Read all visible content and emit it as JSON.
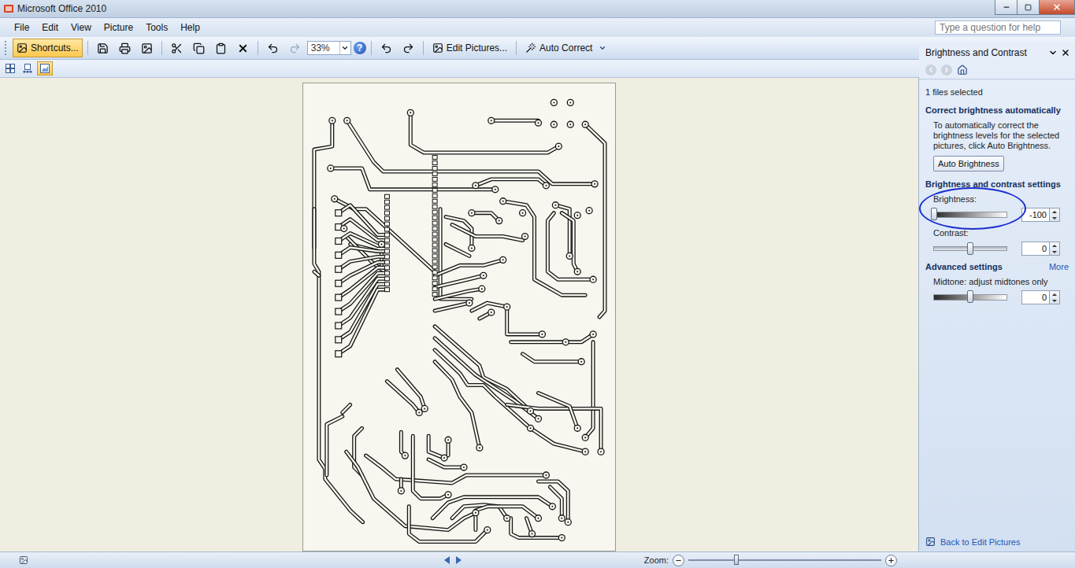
{
  "window": {
    "title": "Microsoft Office 2010"
  },
  "menu": [
    "File",
    "Edit",
    "View",
    "Picture",
    "Tools",
    "Help"
  ],
  "help_search": {
    "placeholder": "Type a question for help"
  },
  "toolbar": {
    "shortcuts": {
      "label": "Shortcuts...",
      "selected": true
    },
    "zoom": "33%",
    "help_glyph": "?",
    "edit_pictures": "Edit Pictures...",
    "auto_correct": "Auto Correct"
  },
  "view_buttons": [
    {
      "kind": "thumbnails",
      "selected": false
    },
    {
      "kind": "filmstrip",
      "selected": false
    },
    {
      "kind": "single",
      "selected": true
    }
  ],
  "task_pane": {
    "title": "Brightness and Contrast",
    "files_selected": "1 files selected",
    "auto_section": {
      "heading": "Correct brightness automatically",
      "description": "To automatically correct the brightness levels for the selected pictures, click Auto Brightness.",
      "button": "Auto Brightness"
    },
    "settings_heading": "Brightness and contrast settings",
    "sliders": [
      {
        "label": "Brightness:",
        "kind": "gradient",
        "level": 0,
        "value": "-100",
        "annotated": true
      },
      {
        "label": "Contrast:",
        "kind": "line",
        "level": 0.5,
        "value": "0",
        "annotated": false
      }
    ],
    "advanced": {
      "heading": "Advanced settings",
      "more": "More",
      "sliders": [
        {
          "label": "Midtone: adjust midtones only",
          "kind": "gradient",
          "level": 0.5,
          "value": "0",
          "annotated": false
        }
      ]
    },
    "footer_link": "Back to Edit Pictures"
  },
  "status_bar": {
    "zoom_label": "Zoom:",
    "zoom_level": 0.25
  }
}
